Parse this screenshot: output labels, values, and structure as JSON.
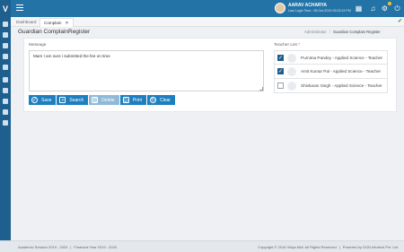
{
  "app": {
    "logo_text": "V"
  },
  "header": {
    "user_name": "AARAV ACHARYA",
    "last_login": "Last Login Time : 06-Oct-2019 03:03:23 PM"
  },
  "tabs": [
    {
      "label": "Dashboard"
    },
    {
      "label": "Complain",
      "close": "✕"
    }
  ],
  "page": {
    "title": "Guardian ComplainRegister",
    "breadcrumb": [
      "Administrator",
      "Guardian Complain Register"
    ]
  },
  "form": {
    "message_label": "Message",
    "message_value": "Mam I am sure i submitted the fee on time",
    "teacher_label": "Teacher List",
    "teacher_required": "*",
    "teachers": [
      {
        "name": "Purnima Pandey - Applied Science - Teacher",
        "checked": true
      },
      {
        "name": "Amit Kumar Pal - Applied Science - Teacher",
        "checked": true
      },
      {
        "name": "Shivkaran Singh - Applied Science - Teacher",
        "checked": false
      }
    ]
  },
  "buttons": {
    "save": "Save",
    "search": "Search",
    "delete": "Delete",
    "print": "Print",
    "clear": "Clear"
  },
  "footer": {
    "academic_session": "Academic Session 2019 - 2020",
    "financial_year": "Financial Year 2019 - 2020",
    "copyright": "Copyright © 2016 Vidya Nidi. All Rights Reserved",
    "powered_by": "Powered by DGN Infotech Pvt. Ltd."
  },
  "colors": {
    "sidebar": "#1f5f8e",
    "topbar": "#2373a7",
    "button": "#1e7fc0"
  }
}
